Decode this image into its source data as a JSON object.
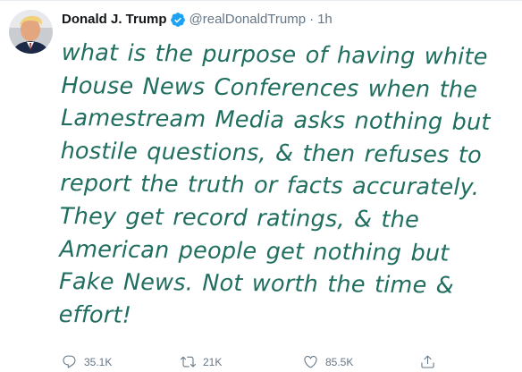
{
  "author": {
    "name": "Donald J. Trump",
    "handle": "@realDonaldTrump",
    "separator": "·",
    "time": "1h",
    "verified": true
  },
  "tweet": {
    "lines": [
      "what is the purpose of having white",
      "House News Conferences when the",
      "Lamestream Media asks nothing but",
      "hostile questions, & then refuses to",
      "report the truth or facts accurately.",
      "They get record ratings, & the",
      "American people get nothing but",
      "Fake News. Not worth the time &",
      "effort!"
    ],
    "text_color": "#1f6e5f"
  },
  "actions": {
    "reply": {
      "icon": "reply-icon",
      "count": "35.1K"
    },
    "retweet": {
      "icon": "retweet-icon",
      "count": "21K"
    },
    "like": {
      "icon": "heart-icon",
      "count": "85.5K"
    },
    "share": {
      "icon": "share-icon"
    }
  },
  "colors": {
    "muted": "#657786",
    "verified": "#1da1f2",
    "name": "#14171a"
  }
}
